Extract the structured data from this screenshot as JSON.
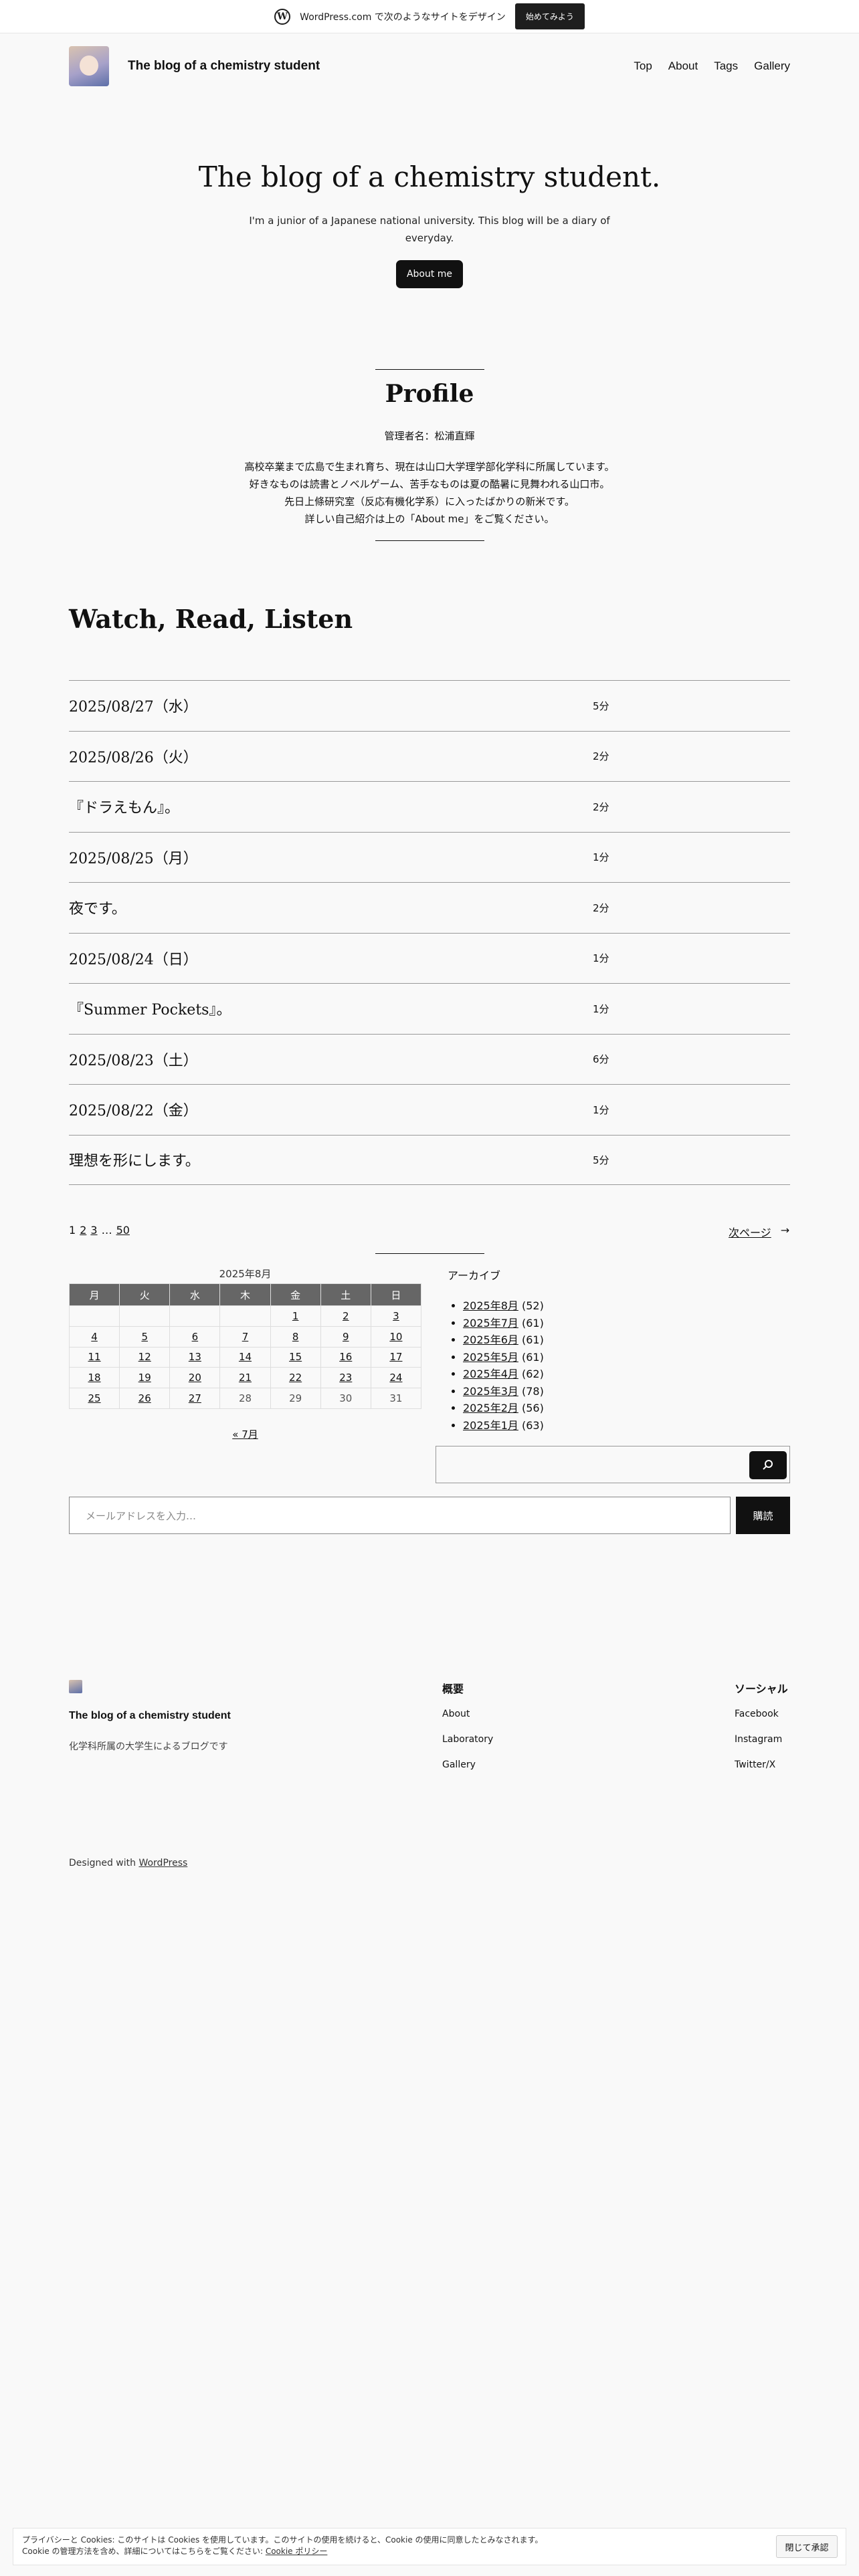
{
  "promo": {
    "text": "WordPress.com で次のようなサイトをデザイン",
    "button": "始めてみよう"
  },
  "header": {
    "site_title": "The blog of a chemistry student",
    "nav": [
      "Top",
      "About",
      "Tags",
      "Gallery"
    ]
  },
  "hero": {
    "title": "The blog of a chemistry student.",
    "subtitle": "I'm a junior of a Japanese national university. This blog will be a diary of everyday.",
    "button": "About me"
  },
  "profile": {
    "title": "Profile",
    "admin": "管理者名：松浦直輝",
    "lines": [
      "高校卒業まで広島で生まれ育ち、現在は山口大学理学部化学科に所属しています。",
      "好きなものは読書とノベルゲーム、苦手なものは夏の酷暑に見舞われる山口市。",
      "先日上條研究室（反応有機化学系）に入ったばかりの新米です。",
      "詳しい自己紹介は上の「About me」をご覧ください。"
    ]
  },
  "section_title": "Watch, Read, Listen",
  "posts": [
    {
      "title": "2025/08/27（水）",
      "time": "5分"
    },
    {
      "title": "2025/08/26（火）",
      "time": "2分"
    },
    {
      "title": "『ドラえもん』。",
      "time": "2分"
    },
    {
      "title": "2025/08/25（月）",
      "time": "1分"
    },
    {
      "title": "夜です。",
      "time": "2分"
    },
    {
      "title": "2025/08/24（日）",
      "time": "1分"
    },
    {
      "title": "『Summer Pockets』。",
      "time": "1分"
    },
    {
      "title": "2025/08/23（土）",
      "time": "6分"
    },
    {
      "title": "2025/08/22（金）",
      "time": "1分"
    },
    {
      "title": "理想を形にします。",
      "time": "5分"
    }
  ],
  "pagination": {
    "pages": [
      "1",
      "2",
      "3",
      "…",
      "50"
    ],
    "next": "次ページ",
    "next_arrow": "→"
  },
  "calendar": {
    "caption": "2025年8月",
    "weekdays": [
      "月",
      "火",
      "水",
      "木",
      "金",
      "土",
      "日"
    ],
    "rows": [
      [
        "",
        "",
        "",
        "",
        "1",
        "2",
        "3"
      ],
      [
        "4",
        "5",
        "6",
        "7",
        "8",
        "9",
        "10"
      ],
      [
        "11",
        "12",
        "13",
        "14",
        "15",
        "16",
        "17"
      ],
      [
        "18",
        "19",
        "20",
        "21",
        "22",
        "23",
        "24"
      ],
      [
        "25",
        "26",
        "27",
        "28",
        "29",
        "30",
        "31"
      ]
    ],
    "prev": "« 7月"
  },
  "archive": {
    "heading": "アーカイブ",
    "items": [
      {
        "label": "2025年8月",
        "count": "(52)"
      },
      {
        "label": "2025年7月",
        "count": "(61)"
      },
      {
        "label": "2025年6月",
        "count": "(61)"
      },
      {
        "label": "2025年5月",
        "count": "(61)"
      },
      {
        "label": "2025年4月",
        "count": "(62)"
      },
      {
        "label": "2025年3月",
        "count": "(78)"
      },
      {
        "label": "2025年2月",
        "count": "(56)"
      },
      {
        "label": "2025年1月",
        "count": "(63)"
      }
    ]
  },
  "search": {
    "icon": "search-icon"
  },
  "subscribe": {
    "placeholder": "メールアドレスを入力…",
    "button": "購読"
  },
  "footer": {
    "title": "The blog of a chemistry student",
    "description": "化学科所属の大学生によるブログです",
    "col1": {
      "heading": "概要",
      "links": [
        "About",
        "Laboratory",
        "Gallery"
      ]
    },
    "col2": {
      "heading": "ソーシャル",
      "links": [
        "Facebook",
        "Instagram",
        "Twitter/X"
      ]
    },
    "credit_prefix": "Designed with",
    "credit_link": "WordPress"
  },
  "cookie": {
    "line1": "プライバシーと Cookies: このサイトは Cookies を使用しています。このサイトの使用を続けると、Cookie の使用に同意したとみなされます。",
    "line2": "Cookie の管理方法を含め、詳細についてはこちらをご覧ください:",
    "link": "Cookie ポリシー",
    "button": "閉じて承認"
  }
}
